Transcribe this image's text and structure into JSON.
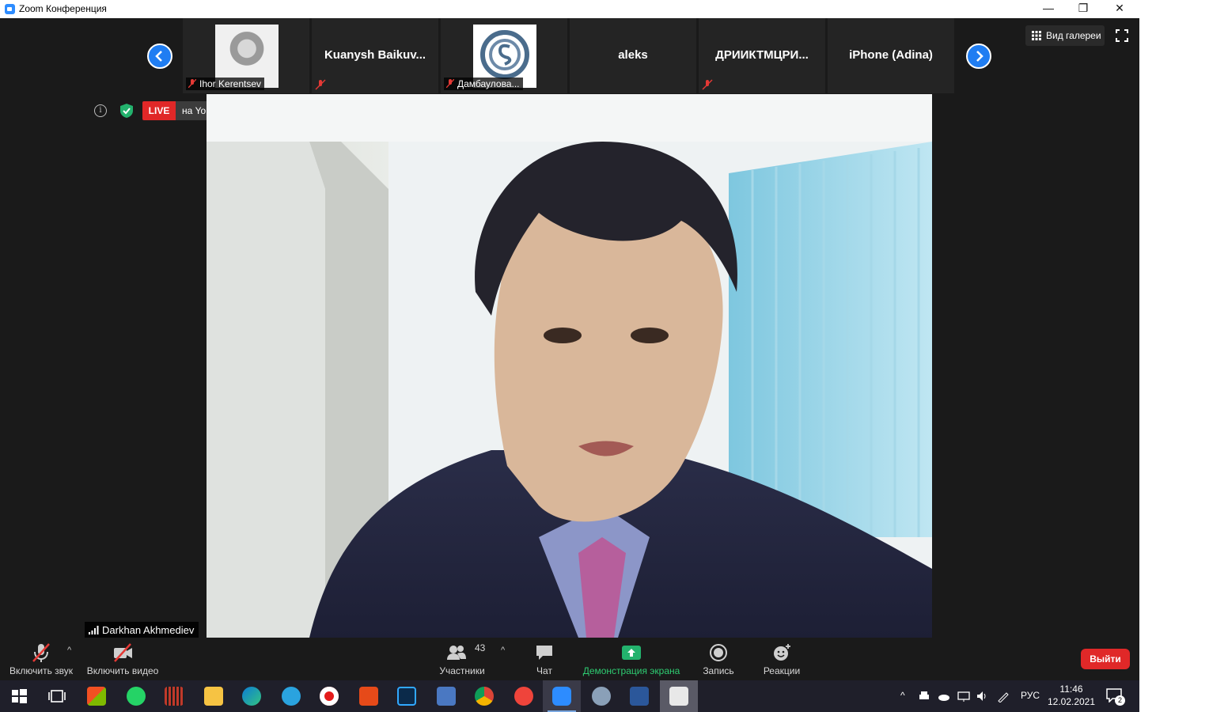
{
  "window": {
    "title": "Zoom Конференция",
    "controls": {
      "minimize": "—",
      "maximize": "❐",
      "close": "✕"
    }
  },
  "participants_strip": {
    "tiles": [
      {
        "name": "Ihor Kerentsev",
        "has_video": true,
        "muted": true
      },
      {
        "name": "Kuanysh  Baikuv...",
        "muted": true
      },
      {
        "name": "Дамбаулова...",
        "has_video": true,
        "muted": true
      },
      {
        "name": "aleks",
        "muted": false
      },
      {
        "name": "ДРИИКТМЦРИ...",
        "muted": true
      },
      {
        "name": "iPhone (Adina)",
        "muted": false
      }
    ],
    "prev_icon": "chevron-left-icon",
    "next_icon": "chevron-right-icon"
  },
  "view": {
    "gallery_label": "Вид галереи",
    "fullscreen_icon": "fullscreen-icon"
  },
  "meeting_status": {
    "info_icon": "info-icon",
    "security_icon": "shield-check-icon",
    "live_label": "LIVE",
    "live_destination": "на YouTube"
  },
  "active_speaker": {
    "name": "Darkhan Akhmediev"
  },
  "toolbar": {
    "audio_label": "Включить звук",
    "video_label": "Включить видео",
    "participants_label": "Участники",
    "participants_count": "43",
    "chat_label": "Чат",
    "share_label": "Демонстрация экрана",
    "record_label": "Запись",
    "reactions_label": "Реакции",
    "leave_label": "Выйти"
  },
  "taskbar": {
    "apps": [
      "windows-start-icon",
      "task-view-icon",
      "store-icon",
      "whatsapp-icon",
      "audio-app-icon",
      "file-explorer-icon",
      "edge-icon",
      "telegram-icon",
      "yandex-icon",
      "office-icon",
      "photoshop-icon",
      "generic-app-icon",
      "chrome-icon",
      "anydesk-icon",
      "zoom-icon",
      "app-icon",
      "word-icon",
      "printer-app-icon"
    ],
    "language": "РУС",
    "time": "11:46",
    "date": "12.02.2021",
    "notifications_count": "2"
  },
  "colors": {
    "zoom_bg": "#1a1a1a",
    "accent_blue": "#1f7df2",
    "live_red": "#e02828",
    "share_green": "#2ecc71"
  }
}
